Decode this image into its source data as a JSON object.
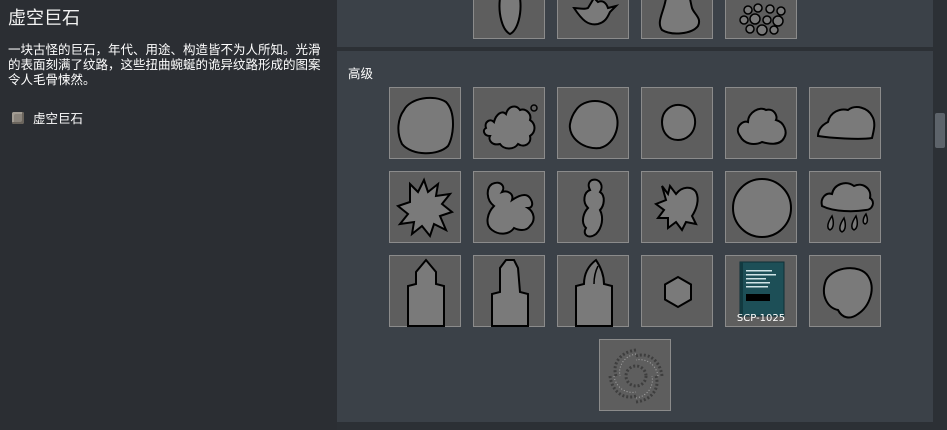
{
  "item": {
    "title": "虚空巨石",
    "description": "一块古怪的巨石，年代、用途、构造皆不为人所知。光滑的表面刻满了纹路，这些扭曲蜿蜒的诡异纹路形成的图案令人毛骨悚然。",
    "entry_label": "虚空巨石",
    "entry_icon": "stone-icon"
  },
  "grid": {
    "section_label": "高级",
    "tiles_top": [
      "vase-blob-icon",
      "bird-blob-icon",
      "lumpy-blob-icon",
      "pebbles-icon"
    ],
    "tiles": [
      "round-blob-icon",
      "splat-blob-icon",
      "rounded-blob-icon",
      "small-circle-icon",
      "amoeba-blob-icon",
      "cloud-blob-icon",
      "spiky-blob-icon",
      "beast-blob-icon",
      "figure-blob-icon",
      "leaf-splat-icon",
      "large-circle-icon",
      "rain-cloud-icon",
      "tombstone-a-icon",
      "tombstone-b-icon",
      "tombstone-c-icon",
      "hexagon-icon",
      "book-icon",
      "egg-blob-icon",
      "swirl-texture-icon"
    ],
    "book_caption": "SCP-1025"
  },
  "colors": {
    "left_bg": "#2b2e33",
    "grid_bg": "#3b4148",
    "tile_bg": "#5e5e5e",
    "tile_border": "#8b8b8b",
    "shape_fill": "#7a7a7a",
    "book_cover": "#1d4f57"
  }
}
